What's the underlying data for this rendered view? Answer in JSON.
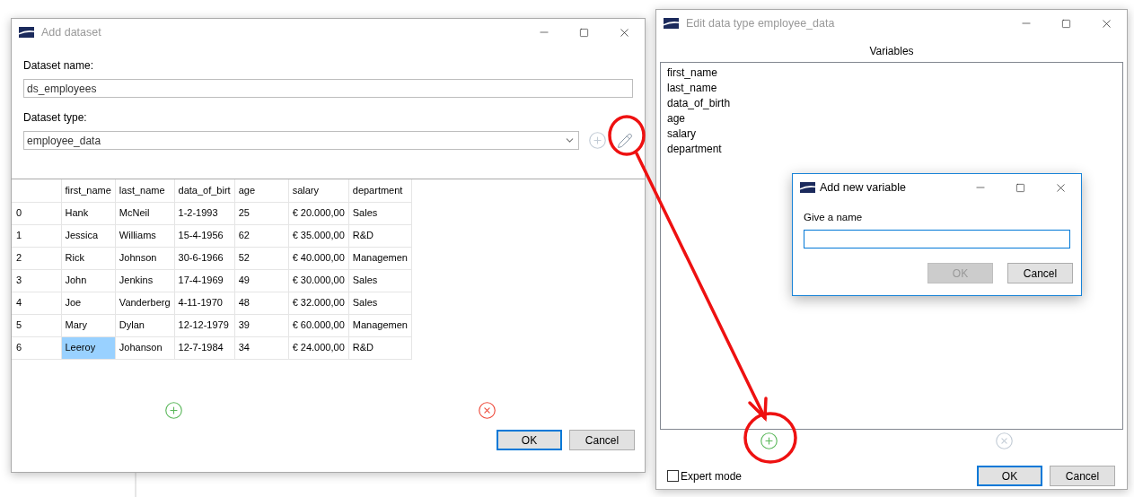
{
  "add_dataset": {
    "title": "Add dataset",
    "active": false,
    "name_label": "Dataset name:",
    "name_value": "ds_employees",
    "type_label": "Dataset type:",
    "type_value": "employee_data",
    "add_type_disabled": true,
    "table": {
      "columns": [
        "first_name",
        "last_name",
        "data_of_birt",
        "age",
        "salary",
        "department"
      ],
      "rows": [
        {
          "index": "0",
          "cells": [
            {
              "text": "Hank",
              "selected": false
            },
            {
              "text": "McNeil",
              "selected": false
            },
            {
              "text": "1-2-1993",
              "selected": false
            },
            {
              "text": "25",
              "selected": false
            },
            {
              "text": "€ 20.000,00",
              "selected": false
            },
            {
              "text": "Sales",
              "selected": false
            }
          ]
        },
        {
          "index": "1",
          "cells": [
            {
              "text": "Jessica",
              "selected": false
            },
            {
              "text": "Williams",
              "selected": false
            },
            {
              "text": "15-4-1956",
              "selected": false
            },
            {
              "text": "62",
              "selected": false
            },
            {
              "text": "€ 35.000,00",
              "selected": false
            },
            {
              "text": "R&D",
              "selected": false
            }
          ]
        },
        {
          "index": "2",
          "cells": [
            {
              "text": "Rick",
              "selected": false
            },
            {
              "text": "Johnson",
              "selected": false
            },
            {
              "text": "30-6-1966",
              "selected": false
            },
            {
              "text": "52",
              "selected": false
            },
            {
              "text": "€ 40.000,00",
              "selected": false
            },
            {
              "text": "Managemen",
              "selected": false
            }
          ]
        },
        {
          "index": "3",
          "cells": [
            {
              "text": "John",
              "selected": false
            },
            {
              "text": "Jenkins",
              "selected": false
            },
            {
              "text": "17-4-1969",
              "selected": false
            },
            {
              "text": "49",
              "selected": false
            },
            {
              "text": "€ 30.000,00",
              "selected": false
            },
            {
              "text": "Sales",
              "selected": false
            }
          ]
        },
        {
          "index": "4",
          "cells": [
            {
              "text": "Joe",
              "selected": false
            },
            {
              "text": "Vanderberg",
              "selected": false
            },
            {
              "text": "4-11-1970",
              "selected": false
            },
            {
              "text": "48",
              "selected": false
            },
            {
              "text": "€ 32.000,00",
              "selected": false
            },
            {
              "text": "Sales",
              "selected": false
            }
          ]
        },
        {
          "index": "5",
          "cells": [
            {
              "text": "Mary",
              "selected": false
            },
            {
              "text": "Dylan",
              "selected": false
            },
            {
              "text": "12-12-1979",
              "selected": false
            },
            {
              "text": "39",
              "selected": false
            },
            {
              "text": "€ 60.000,00",
              "selected": false
            },
            {
              "text": "Managemen",
              "selected": false
            }
          ]
        },
        {
          "index": "6",
          "cells": [
            {
              "text": "Leeroy",
              "selected": true
            },
            {
              "text": "Johanson",
              "selected": false
            },
            {
              "text": "12-7-1984",
              "selected": false
            },
            {
              "text": "34",
              "selected": false
            },
            {
              "text": "€ 24.000,00",
              "selected": false
            },
            {
              "text": "R&D",
              "selected": false
            }
          ]
        }
      ]
    },
    "add_row_disabled": false,
    "remove_row_disabled": false,
    "buttons": [
      {
        "label": "OK",
        "default": true,
        "disabled": false
      },
      {
        "label": "Cancel",
        "default": false,
        "disabled": false
      }
    ]
  },
  "edit_data_type": {
    "title": "Edit data type employee_data",
    "active": false,
    "list_title": "Variables",
    "variables": [
      "first_name",
      "last_name",
      "data_of_birth",
      "age",
      "salary",
      "department"
    ],
    "add_disabled": false,
    "remove_disabled": true,
    "expert_mode": {
      "label": "Expert mode",
      "checked": false
    },
    "buttons": [
      {
        "label": "OK",
        "default": true,
        "disabled": false
      },
      {
        "label": "Cancel",
        "default": false,
        "disabled": false
      }
    ]
  },
  "add_variable": {
    "title": "Add new variable",
    "active": true,
    "prompt": "Give a name",
    "focused": true,
    "buttons": [
      {
        "label": "OK",
        "default": false,
        "disabled": true
      },
      {
        "label": "Cancel",
        "default": false,
        "disabled": false
      }
    ]
  }
}
